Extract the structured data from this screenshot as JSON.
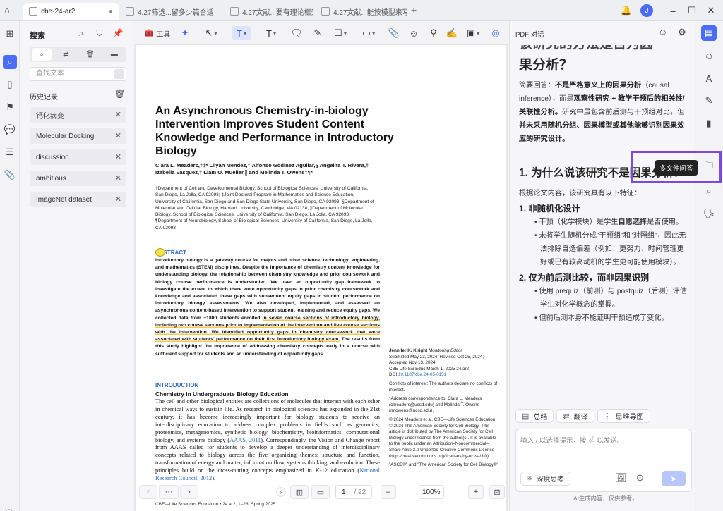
{
  "tabs": [
    {
      "label": "cbe-24-ar2",
      "active": true
    },
    {
      "label": "4.27筛选...留多少篇合适",
      "active": false
    },
    {
      "label": "4.27文献...要有理论框架",
      "active": false
    },
    {
      "label": "4.27文献...能按模型来写",
      "active": false
    }
  ],
  "tab_add": "+",
  "user_avatar": "J",
  "search_panel": {
    "title": "搜索",
    "placeholder": "查找文本",
    "history_title": "历史记录",
    "history": [
      "钙化病变",
      "Molecular Docking",
      "discussion",
      "ambitious",
      "ImageNet dataset"
    ]
  },
  "toolbar": {
    "tools_label": "工具"
  },
  "document": {
    "title": "An Asynchronous Chemistry-in-biology Intervention Improves Student Content Knowledge and Performance in Introductory Biology",
    "authors": "Clara L. Meaders,†‡* Lilyan Mendez,† Alfonso Godinez Aguilar,§ Angelita T. Rivera,† Izabella Vasquez,† Liam O. Mueller,∥ and Melinda T. Owens†¶*",
    "affiliations": "†Department of Cell and Developmental Biology, School of Biological Sciences, University of California, San Diego, La Jolla, CA 92093; ‡Joint Doctoral Program in Mathematics and Science Education, University of California, San Diego and San Diego State University, San Diego, CA 92093; §Department of Molecular and Cellular Biology, Harvard University, Cambridge, MA 02138; ∥Department of Molecular Biology, School of Biological Sciences, University of California, San Diego, La Jolla, CA 92093; ¶Department of Neurobiology, School of Biological Sciences, University of California, San Diego, La Jolla, CA 92093",
    "abstract_heading": "ABSTRACT",
    "abstract_a": "Introductory biology is a gateway course for majors and other science, technology, engineering, and mathematics (STEM) disciplines. Despite the importance of chemistry content knowledge for understanding biology, the relationship between chemistry knowledge and prior coursework and biology course performance is understudied. We used an opportunity gap framework to investigate the extent to which there were opportunity gaps in prior chemistry coursework and knowledge and associated these gaps with subsequent equity gaps in student performance on introductory biology assessments. We also developed, implemented, and assessed an asynchronous content-based intervention to support student learning and reduce equity gaps. We collected data from ~1800 students enrolled ",
    "abstract_hl": "in seven course sections of introductory biology, including two course sections prior to implementation of the intervention and five course sections with the intervention. We identified opportunity gaps in chemistry coursework that were associated with students' performance on their first introductory biology exam.",
    "abstract_b": " The results from this study highlight the importance of addressing chemistry concepts early in a course with sufficient support for students and an understanding of opportunity gaps.",
    "intro_heading": "INTRODUCTION",
    "intro_subheading": "Chemistry in Undergraduate Biology Education",
    "intro_text_a": "The cell and other biological entities are collections of molecules that interact with each other in chemical ways to sustain life. As research in biological sciences has expanded in the 21st century, it has become increasingly important for biology students to receive an interdisciplinary education to address complex problems in fields such as genomics, proteomics, metagenomics, synthetic biology, biochemistry, bioinformatics, computational biology, and systems biology (",
    "intro_ref1": "AAAS, 2011",
    "intro_text_b": "). Correspondingly, the Vision and Change report from AAAS called for students to develop a deeper understanding of interdisciplinary concepts related to biology across the five organizing themes: structure and function, transformation of energy and matter, information flow, systems thinking, and evolution. These principles build on the cross-cutting concepts emphasized in K-12 education (",
    "intro_ref2": "National Research Council, 2012",
    "intro_text_c": ").",
    "side_editor_name": "Jennifer K. Knight",
    "side_editor_role": " Monitoring Editor",
    "side_dates": "Submitted May 23, 2024; Revised Oct 25, 2024; Accepted Nov 13, 2024",
    "side_journal": "CBE Life Sci Educ March 1, 2025 24:ar2",
    "side_doi_label": "DOI:",
    "side_doi": "10.1187/cbe.24-05-0151",
    "side_conflicts": "Conflicts of interest: The authors declare no conflicts of interest.",
    "side_corr": "*Address correspondence to: Clara L. Meaders (cmeaders@ucsd.edu) and Melinda T. Owens (mtowens@ucsd.edu).",
    "side_copyright": "© 2024 Meaders et al. CBE—Life Sciences Education © 2024 The American Society for Cell Biology. This article is distributed by The American Society for Cell Biology under license from the author(s). It is available to the public under an Attribution–Noncommercial–Share Alike 3.0 Unported Creative Commons License (http://creativecommons.org/licenses/by-nc-sa/3.0).",
    "side_ascb": "\"ASCB®\" and \"The American Society for Cell Biology®\"",
    "footer": "CBE—Life Sciences Education • 24:ar2, 1–23, Spring 2025"
  },
  "nav": {
    "page_current": "1",
    "page_total": "/ 22",
    "zoom": "100%",
    "more": "···"
  },
  "chat": {
    "title": "PDF 对话",
    "heading_cut": "该研究的方法是否为因",
    "heading_tail": "果分析？",
    "answer_label": "简要回答：",
    "answer_b1": "不是严格意义上的因果分析",
    "answer_t1": "（causal inference），而是",
    "answer_b2": "观察性研究 + 教学干预后的相关性/关联性分析。",
    "answer_t2": "研究中虽包含前后测与干预组对比，但",
    "answer_b3": "并未采用随机分组、因果模型或其他能够识别因果效应的研究设计。",
    "h1": "1. 为什么说该研究不是因果分析？",
    "p1": "根据论文内容，该研究具有以下特征：",
    "h2a": "1. 非随机化设计",
    "li1a": "干预（化学模块）是学生",
    "li1b": "自愿选择",
    "li1c": "是否使用。",
    "li2": "未将学生随机分成\"干预组\"和\"对照组\"，因此无法排除自选偏差（例如：更努力、时间管理更好或已有较高动机的学生更可能使用模块）。",
    "h2b": "2. 仅为前后测比较，而非因果识别",
    "li3": "使用 prequiz（前测）与 postquiz（后测）评估学生对化学概念的掌握。",
    "li4": "但前后测本身不能证明干预造成了变化。",
    "actions": [
      "总结",
      "翻译",
      "思维导图"
    ],
    "input_placeholder": "输入 / 以选择提示，按 ⏎ 以发送。",
    "deep_think": "深度思考",
    "disclaimer": "AI生成内容，仅供参考。",
    "tooltip": "多文件问答"
  }
}
